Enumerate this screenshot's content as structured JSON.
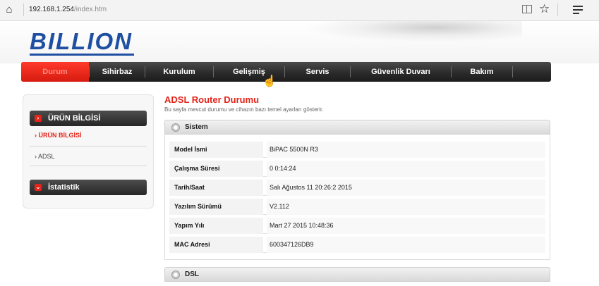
{
  "browser": {
    "url_host": "192.168.1.254",
    "url_path": "/index.htm"
  },
  "brand": {
    "logo_text": "BILLION",
    "accent_color": "#e3241a",
    "logo_color": "#1f4fa3"
  },
  "nav": {
    "items": [
      {
        "label": "Durum",
        "active": true
      },
      {
        "label": "Sihirbaz",
        "active": false
      },
      {
        "label": "Kurulum",
        "active": false
      },
      {
        "label": "Gelişmiş",
        "active": false
      },
      {
        "label": "Servis",
        "active": false
      },
      {
        "label": "Güvenlik Duvarı",
        "active": false
      },
      {
        "label": "Bakım",
        "active": false
      }
    ]
  },
  "sidebar": {
    "section1_title": "ÜRÜN BİLGİSİ",
    "section1_items": [
      {
        "label": "ÜRÜN BİLGİSİ",
        "active": true
      },
      {
        "label": "ADSL",
        "active": false
      }
    ],
    "section2_title": "İstatistik",
    "bullet_expanded": "›",
    "bullet_collapsed": "⌄"
  },
  "main": {
    "title": "ADSL Router Durumu",
    "subtitle": "Bu sayfa mevcut durumu ve cihazın bazı temel ayarları gösterir.",
    "system_section_title": "Sistem",
    "system_rows": [
      {
        "label": "Model İsmi",
        "value": "BiPAC 5500N R3"
      },
      {
        "label": "Çalışma Süresi",
        "value": "0 0:14:24"
      },
      {
        "label": "Tarih/Saat",
        "value": "Salı Ağustos 11 20:26:2 2015"
      },
      {
        "label": "Yazılım Sürümü",
        "value": "V2.112"
      },
      {
        "label": "Yapım Yılı",
        "value": "Mart 27 2015 10:48:36"
      },
      {
        "label": "MAC Adresi",
        "value": "600347126DB9"
      }
    ],
    "dsl_section_title": "DSL"
  },
  "icons": {
    "home": "home-icon",
    "reading_view": "reading-view-icon",
    "favorite": "star-icon",
    "menu": "hamburger-menu-icon",
    "section": "gear-icon",
    "cursor": "hand-cursor-icon"
  }
}
